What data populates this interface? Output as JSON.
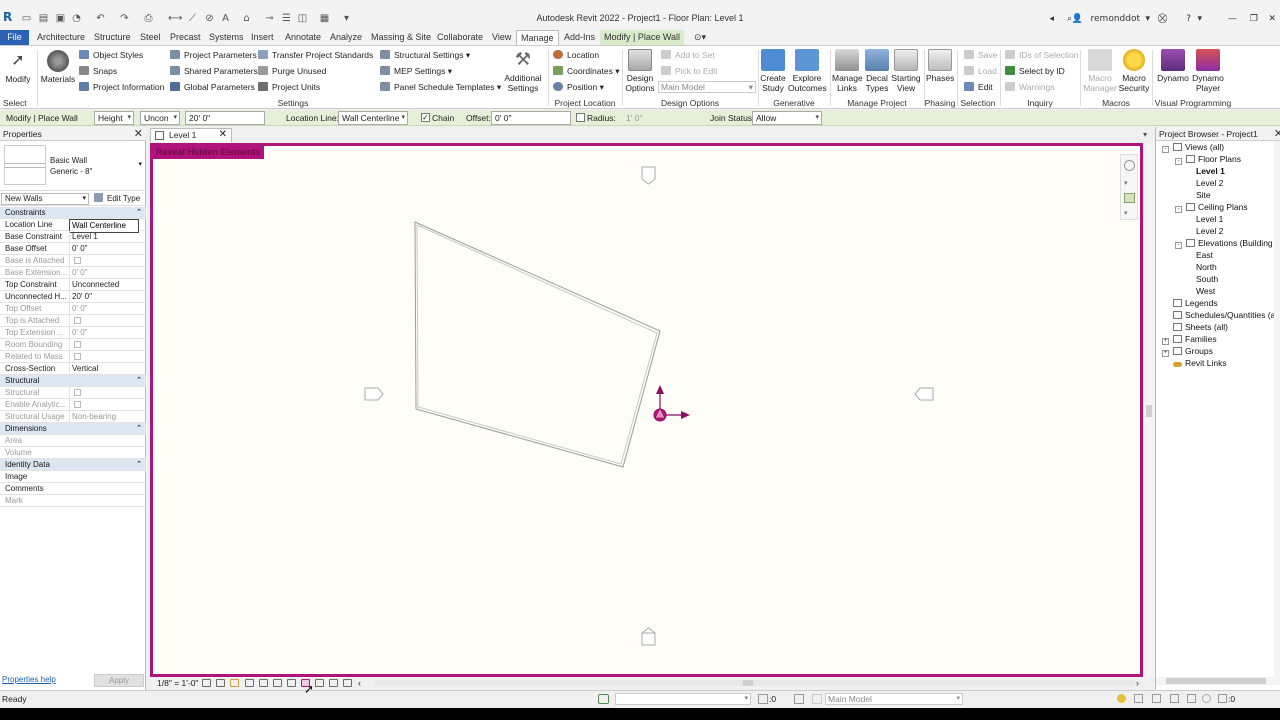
{
  "app": {
    "logo": "R",
    "window_title": "Autodesk Revit 2022 - Project1 - Floor Plan: Level 1",
    "user": "remonddot",
    "help": "?"
  },
  "ribbon_tabs": [
    "File",
    "Architecture",
    "Structure",
    "Steel",
    "Precast",
    "Systems",
    "Insert",
    "Annotate",
    "Analyze",
    "Massing & Site",
    "Collaborate",
    "View",
    "Manage",
    "Add-Ins",
    "Modify | Place Wall"
  ],
  "ribbon": {
    "modify": "Modify",
    "materials": "Materials",
    "object_styles": "Object  Styles",
    "snaps": "Snaps",
    "project_information": "Project  Information",
    "project_parameters": "Project  Parameters",
    "shared_parameters": "Shared  Parameters",
    "global_parameters": "Global  Parameters",
    "transfer_standards": "Transfer  Project Standards",
    "purge_unused": "Purge  Unused",
    "project_units": "Project  Units",
    "structural_settings": "Structural  Settings",
    "mep_settings": "MEP  Settings",
    "panel_schedule_templates": "Panel Schedule  Templates",
    "additional_settings_1": "Additional",
    "additional_settings_2": "Settings",
    "location": "Location",
    "coordinates": "Coordinates",
    "position": "Position",
    "design_options_1": "Design",
    "design_options_2": "Options",
    "add_to_set": "Add to Set",
    "pick_to_edit": "Pick to Edit",
    "main_model": "Main Model",
    "create_study_1": "Create",
    "create_study_2": "Study",
    "explore_outcomes_1": "Explore",
    "explore_outcomes_2": "Outcomes",
    "manage_links_1": "Manage",
    "manage_links_2": "Links",
    "decal_types_1": "Decal",
    "decal_types_2": "Types",
    "starting_view_1": "Starting",
    "starting_view_2": "View",
    "phases": "Phases",
    "save": "Save",
    "load": "Load",
    "edit": "Edit",
    "ids_of_selection": "IDs  of  Selection",
    "select_by_id": "Select  by ID",
    "warnings": "Warnings",
    "macro_manager_1": "Macro",
    "macro_manager_2": "Manager",
    "macro_security_1": "Macro",
    "macro_security_2": "Security",
    "dynamo": "Dynamo",
    "dynamo_player_1": "Dynamo",
    "dynamo_player_2": "Player",
    "panels": {
      "select": "Select",
      "settings": "Settings",
      "project_location": "Project Location",
      "design_options": "Design Options",
      "generative_design": "Generative Design",
      "manage_project": "Manage Project",
      "phasing": "Phasing",
      "selection": "Selection",
      "inquiry": "Inquiry",
      "macros": "Macros",
      "visual_programming": "Visual Programming"
    }
  },
  "options_bar": {
    "context": "Modify | Place Wall",
    "height_mode": "Height",
    "unconnected": "Uncon",
    "height_value": "20'  0\"",
    "location_line_label": "Location Line:",
    "location_line_value": "Wall Centerline",
    "chain_label": "Chain",
    "offset_label": "Offset:",
    "offset_value": "0'  0\"",
    "radius_label": "Radius:",
    "radius_value": "1'  0\"",
    "join_status_label": "Join Status:",
    "join_status_value": "Allow"
  },
  "properties": {
    "title": "Properties",
    "type_family": "Basic Wall",
    "type_name": "Generic - 8\"",
    "instance_selector": "New Walls",
    "edit_type": "Edit Type",
    "help_link": "Properties help",
    "apply": "Apply",
    "rows": [
      {
        "label": "Constraints",
        "value": "",
        "kind": "cat"
      },
      {
        "label": "Location Line",
        "value": "Wall Centerline",
        "kind": "row"
      },
      {
        "label": "Base Constraint",
        "value": "Level 1",
        "kind": "row"
      },
      {
        "label": "Base Offset",
        "value": "0'  0\"",
        "kind": "row"
      },
      {
        "label": "Base is Attached",
        "value": "",
        "kind": "dim-check"
      },
      {
        "label": "Base Extension ...",
        "value": "0'  0\"",
        "kind": "dim"
      },
      {
        "label": "Top Constraint",
        "value": "Unconnected",
        "kind": "row"
      },
      {
        "label": "Unconnected H...",
        "value": "20'  0\"",
        "kind": "row"
      },
      {
        "label": "Top Offset",
        "value": "0'  0\"",
        "kind": "dim"
      },
      {
        "label": "Top is Attached",
        "value": "",
        "kind": "dim-check"
      },
      {
        "label": "Top Extension ...",
        "value": "0'  0\"",
        "kind": "dim"
      },
      {
        "label": "Room Bounding",
        "value": "",
        "kind": "dim-check"
      },
      {
        "label": "Related to Mass",
        "value": "",
        "kind": "dim-check"
      },
      {
        "label": "Cross-Section",
        "value": "Vertical",
        "kind": "row"
      },
      {
        "label": "Structural",
        "value": "",
        "kind": "cat"
      },
      {
        "label": "Structural",
        "value": "",
        "kind": "dim-check"
      },
      {
        "label": "Enable Analytic...",
        "value": "",
        "kind": "dim-check"
      },
      {
        "label": "Structural Usage",
        "value": "Non-bearing",
        "kind": "dim"
      },
      {
        "label": "Dimensions",
        "value": "",
        "kind": "cat"
      },
      {
        "label": "Area",
        "value": "",
        "kind": "dim"
      },
      {
        "label": "Volume",
        "value": "",
        "kind": "dim"
      },
      {
        "label": "Identity Data",
        "value": "",
        "kind": "cat"
      },
      {
        "label": "Image",
        "value": "",
        "kind": "row"
      },
      {
        "label": "Comments",
        "value": "",
        "kind": "row"
      },
      {
        "label": "Mark",
        "value": "",
        "kind": "dim"
      }
    ]
  },
  "view": {
    "tab_label": "Level 1",
    "reveal_label": "Reveal Hidden Elements",
    "scale": "1/8\" = 1'-0\""
  },
  "browser": {
    "title": "Project Browser - Project1",
    "nodes": [
      {
        "label": "Views (all)",
        "depth": 0,
        "exp": "-",
        "bold": false
      },
      {
        "label": "Floor Plans",
        "depth": 1,
        "exp": "-",
        "bold": false
      },
      {
        "label": "Level 1",
        "depth": 2,
        "exp": "",
        "bold": true
      },
      {
        "label": "Level 2",
        "depth": 2,
        "exp": "",
        "bold": false
      },
      {
        "label": "Site",
        "depth": 2,
        "exp": "",
        "bold": false
      },
      {
        "label": "Ceiling Plans",
        "depth": 1,
        "exp": "-",
        "bold": false
      },
      {
        "label": "Level 1",
        "depth": 2,
        "exp": "",
        "bold": false
      },
      {
        "label": "Level 2",
        "depth": 2,
        "exp": "",
        "bold": false
      },
      {
        "label": "Elevations (Building Elevation)",
        "depth": 1,
        "exp": "-",
        "bold": false
      },
      {
        "label": "East",
        "depth": 2,
        "exp": "",
        "bold": false
      },
      {
        "label": "North",
        "depth": 2,
        "exp": "",
        "bold": false
      },
      {
        "label": "South",
        "depth": 2,
        "exp": "",
        "bold": false
      },
      {
        "label": "West",
        "depth": 2,
        "exp": "",
        "bold": false
      },
      {
        "label": "Legends",
        "depth": 0,
        "exp": "",
        "bold": false
      },
      {
        "label": "Schedules/Quantities (all)",
        "depth": 0,
        "exp": "",
        "bold": false
      },
      {
        "label": "Sheets (all)",
        "depth": 0,
        "exp": "",
        "bold": false
      },
      {
        "label": "Families",
        "depth": 0,
        "exp": "+",
        "bold": false
      },
      {
        "label": "Groups",
        "depth": 0,
        "exp": "+",
        "bold": false
      },
      {
        "label": "Revit Links",
        "depth": 0,
        "exp": "",
        "bold": false
      }
    ]
  },
  "status": {
    "text": "Ready",
    "zero": ":0",
    "main_model": "Main Model",
    "zero2": ":0"
  },
  "colors": {
    "accent": "#2b62b5",
    "canvas_border": "#b0137a",
    "contextual_tab": "#d9ecc9",
    "options_bar": "#e6f0d8"
  }
}
